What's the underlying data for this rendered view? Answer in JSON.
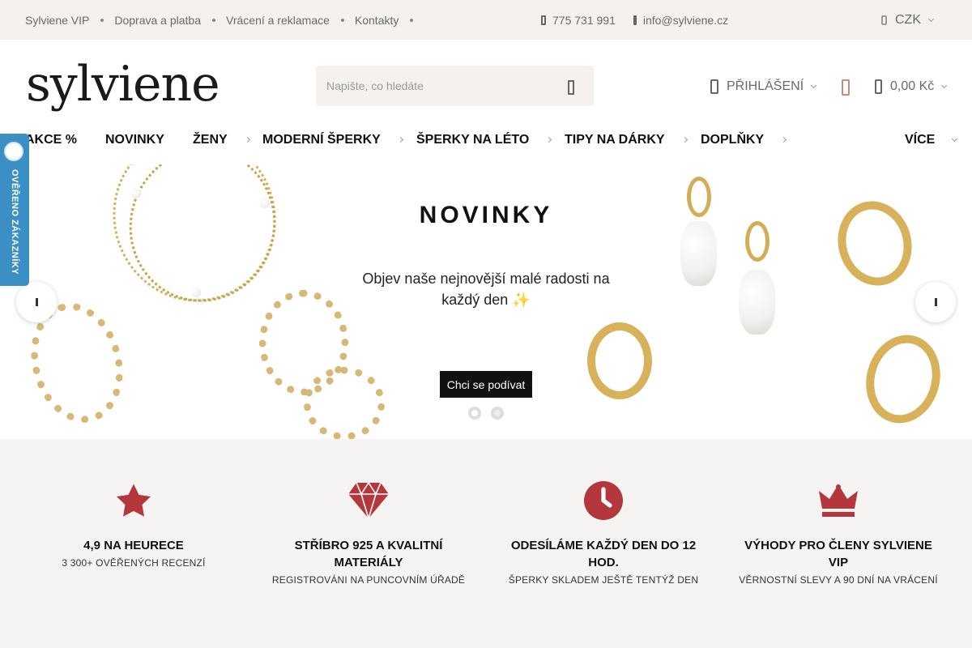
{
  "topbar": {
    "links": [
      "Sylviene VIP",
      "Doprava a platba",
      "Vrácení a reklamace",
      "Kontakty"
    ],
    "phone": "775 731 991",
    "email": "info@sylviene.cz",
    "currency": "CZK"
  },
  "header": {
    "logo": "sylviene",
    "search_placeholder": "Napište, co hledáte",
    "login_label": "PŘIHLÁŠENÍ",
    "cart_total": "0,00 Kč"
  },
  "nav": {
    "items": [
      "AKCE %",
      "NOVINKY",
      "ŽENY",
      "MODERNÍ ŠPERKY",
      "ŠPERKY NA LÉTO",
      "TIPY NA DÁRKY",
      "DOPLŇKY",
      "VÍCE"
    ]
  },
  "verified_badge": "OVĚŘENO ZÁKAZNÍKY",
  "hero": {
    "title": "NOVINKY",
    "subtitle": "Objev naše nejnovější malé radosti na každý den ✨",
    "cta": "Chci se podívat"
  },
  "features": [
    {
      "icon": "star-icon",
      "title": "4,9 NA HEURECE",
      "subtitle": "3 300+ OVĚŘENÝCH RECENZÍ"
    },
    {
      "icon": "diamond-icon",
      "title": "STŘÍBRO 925 A KVALITNÍ MATERIÁLY",
      "subtitle": "REGISTROVÁNI NA PUNCOVNÍM ÚŘADĚ"
    },
    {
      "icon": "clock-icon",
      "title": "ODESÍLÁME KAŽDÝ DEN DO 12 HOD.",
      "subtitle": "ŠPERKY SKLADEM JEŠTĚ TENTÝŽ DEN"
    },
    {
      "icon": "crown-icon",
      "title": "VÝHODY PRO ČLENY SYLVIENE VIP",
      "subtitle": "VĚRNOSTNÍ SLEVY A 90 DNÍ NA VRÁCENÍ"
    }
  ],
  "colors": {
    "topbar_bg": "#f4f1ee",
    "icon_red": "#b3373d",
    "badge_blue": "#3b8fc4",
    "gold": "#d8b25a"
  }
}
